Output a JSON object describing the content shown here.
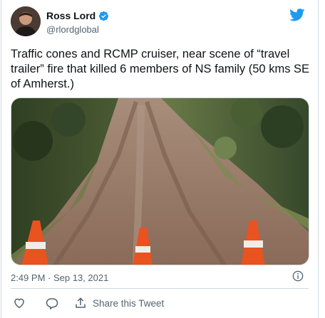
{
  "tweet": {
    "display_name": "Ross Lord",
    "handle": "@rlordglobal",
    "text": "Traffic cones and RCMP cruiser, near scene of “travel trailer” fire that killed 6 members of NS family (50 kms SE of Amherst.)",
    "timestamp": "2:49 PM · Sep 13, 2021",
    "verified": true
  },
  "actions": {
    "share_label": "Share this Tweet"
  },
  "colors": {
    "brand_blue": "#1d9bf0",
    "secondary_text": "#536471",
    "border": "#cfd9de"
  },
  "icons": [
    "twitter-bird-icon",
    "verified-badge-icon",
    "info-icon",
    "heart-icon",
    "reply-icon",
    "share-icon"
  ]
}
